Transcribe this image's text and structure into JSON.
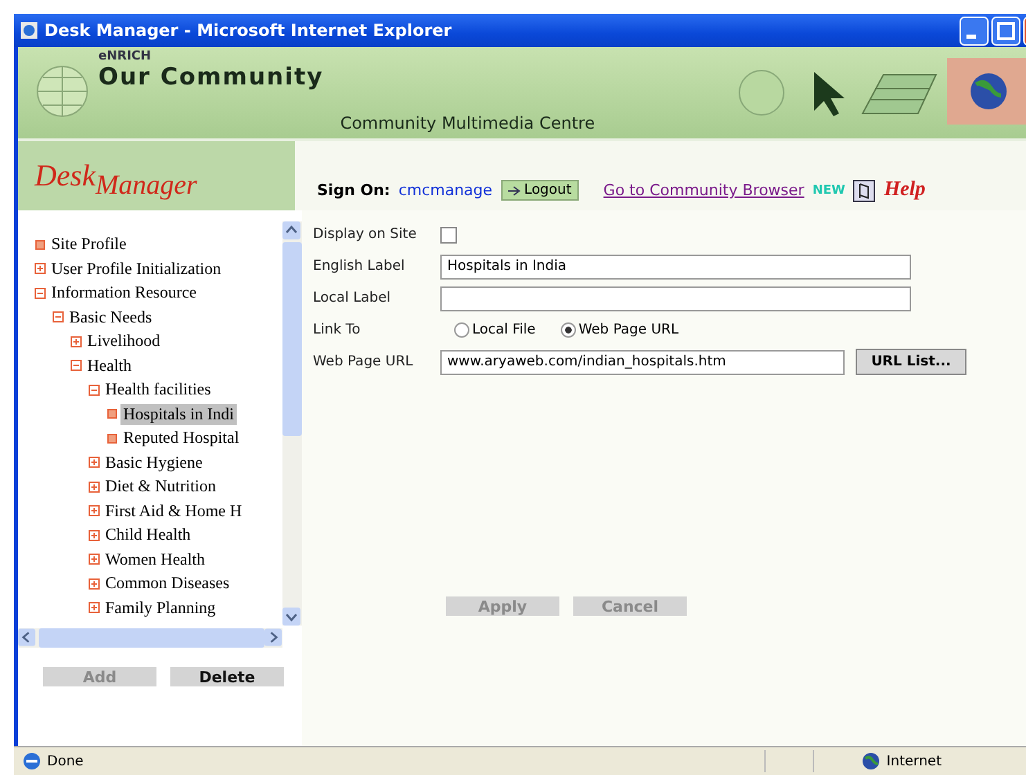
{
  "window": {
    "title": "Desk Manager - Microsoft Internet Explorer"
  },
  "header": {
    "brand": "eNRICH",
    "title": "Our Community",
    "subtitle": "Community Multimedia Centre"
  },
  "logo_words": [
    "Desk",
    "Manager"
  ],
  "session": {
    "label": "Sign On:",
    "user": "cmcmanage",
    "logout": "Logout",
    "browser_link": "Go to Community Browser",
    "new_badge": "NEW",
    "help": "Help"
  },
  "tree": [
    {
      "label": "Site Profile",
      "selected": false
    },
    {
      "label": "User Profile Initialization",
      "selected": false,
      "expanded": false
    },
    {
      "label": "Information Resource",
      "selected": false,
      "expanded": true,
      "children": [
        {
          "label": "Basic Needs",
          "selected": false,
          "expanded": true,
          "children": [
            {
              "label": "Livelihood",
              "selected": false,
              "expanded": false
            },
            {
              "label": "Health",
              "selected": false,
              "expanded": true,
              "children": [
                {
                  "label": "Health facilities",
                  "selected": false,
                  "expanded": true,
                  "children": [
                    {
                      "label": "Hospitals in Indi",
                      "selected": true
                    },
                    {
                      "label": "Reputed Hospital",
                      "selected": false
                    }
                  ]
                },
                {
                  "label": "Basic Hygiene",
                  "selected": false,
                  "expanded": false
                },
                {
                  "label": "Diet & Nutrition",
                  "selected": false,
                  "expanded": false
                },
                {
                  "label": "First Aid & Home H",
                  "selected": false,
                  "expanded": false
                },
                {
                  "label": "Child Health",
                  "selected": false,
                  "expanded": false
                },
                {
                  "label": "Women Health",
                  "selected": false,
                  "expanded": false
                },
                {
                  "label": "Common Diseases",
                  "selected": false,
                  "expanded": false
                },
                {
                  "label": "Family Planning",
                  "selected": false,
                  "expanded": false
                }
              ]
            }
          ]
        }
      ]
    }
  ],
  "tree_buttons": [
    {
      "label": "Add",
      "disabled": true
    },
    {
      "label": "Delete",
      "disabled": false
    }
  ],
  "form": [
    {
      "kind": "checkbox",
      "label": "Display on Site",
      "checked": false
    },
    {
      "kind": "text",
      "label": "English Label",
      "value": "Hospitals in India"
    },
    {
      "kind": "text",
      "label": "Local Label"
    },
    {
      "kind": "radio",
      "label": "Link To",
      "options": [
        {
          "label": "Local File",
          "selected": false
        },
        {
          "label": "Web Page URL",
          "selected": true
        }
      ]
    },
    {
      "kind": "url",
      "label": "Web Page URL",
      "value": "www.aryaweb.com/indian_hospitals.htm",
      "button": "URL List..."
    }
  ],
  "actions": [
    {
      "label": "Apply",
      "disabled": true
    },
    {
      "label": "Cancel",
      "disabled": true
    }
  ],
  "status_bar": {
    "text": "Done",
    "zone": "Internet"
  }
}
